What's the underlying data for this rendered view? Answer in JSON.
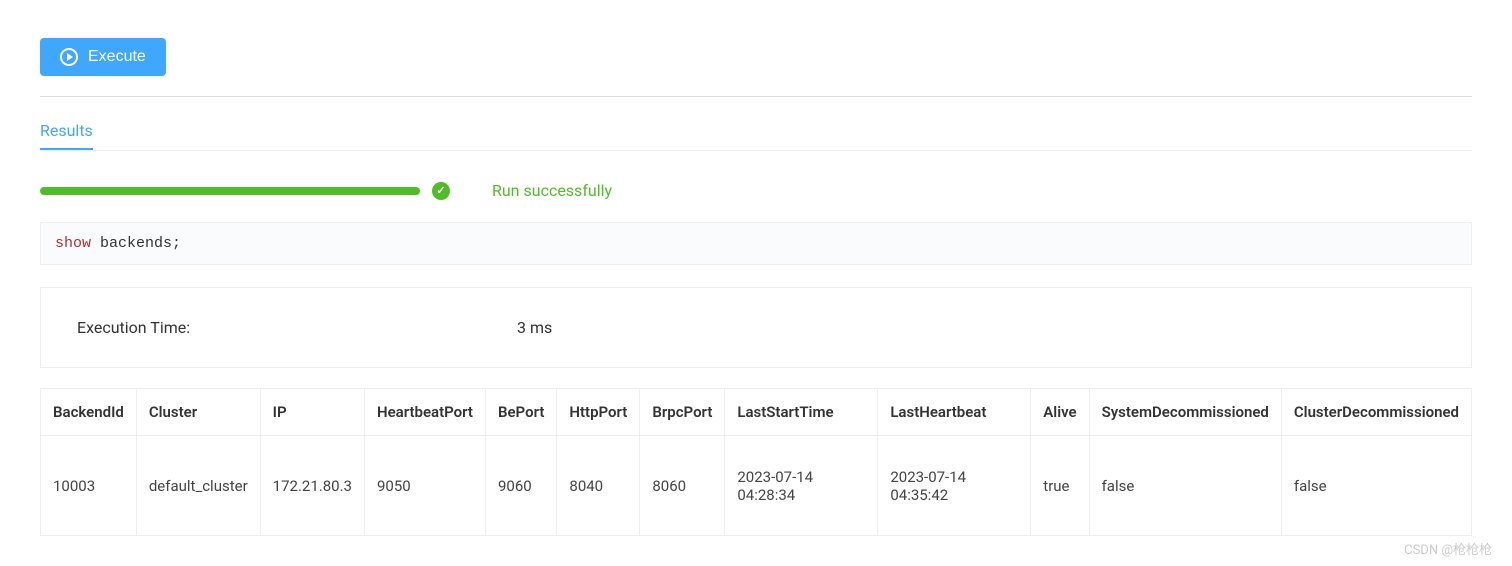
{
  "toolbar": {
    "execute_label": "Execute"
  },
  "tabs": {
    "results": "Results"
  },
  "status": {
    "success_text": "Run successfully"
  },
  "query": {
    "keyword": "show",
    "rest": " backends;"
  },
  "execution": {
    "label": "Execution Time:",
    "value": "3 ms"
  },
  "table": {
    "headers": [
      "BackendId",
      "Cluster",
      "IP",
      "HeartbeatPort",
      "BePort",
      "HttpPort",
      "BrpcPort",
      "LastStartTime",
      "LastHeartbeat",
      "Alive",
      "SystemDecommissioned",
      "ClusterDecommissioned"
    ],
    "rows": [
      {
        "BackendId": "10003",
        "Cluster": "default_cluster",
        "IP": "172.21.80.3",
        "HeartbeatPort": "9050",
        "BePort": "9060",
        "HttpPort": "8040",
        "BrpcPort": "8060",
        "LastStartTime": "2023-07-14 04:28:34",
        "LastHeartbeat": "2023-07-14 04:35:42",
        "Alive": "true",
        "SystemDecommissioned": "false",
        "ClusterDecommissioned": "false"
      }
    ]
  },
  "watermark": "CSDN @枪枪枪"
}
